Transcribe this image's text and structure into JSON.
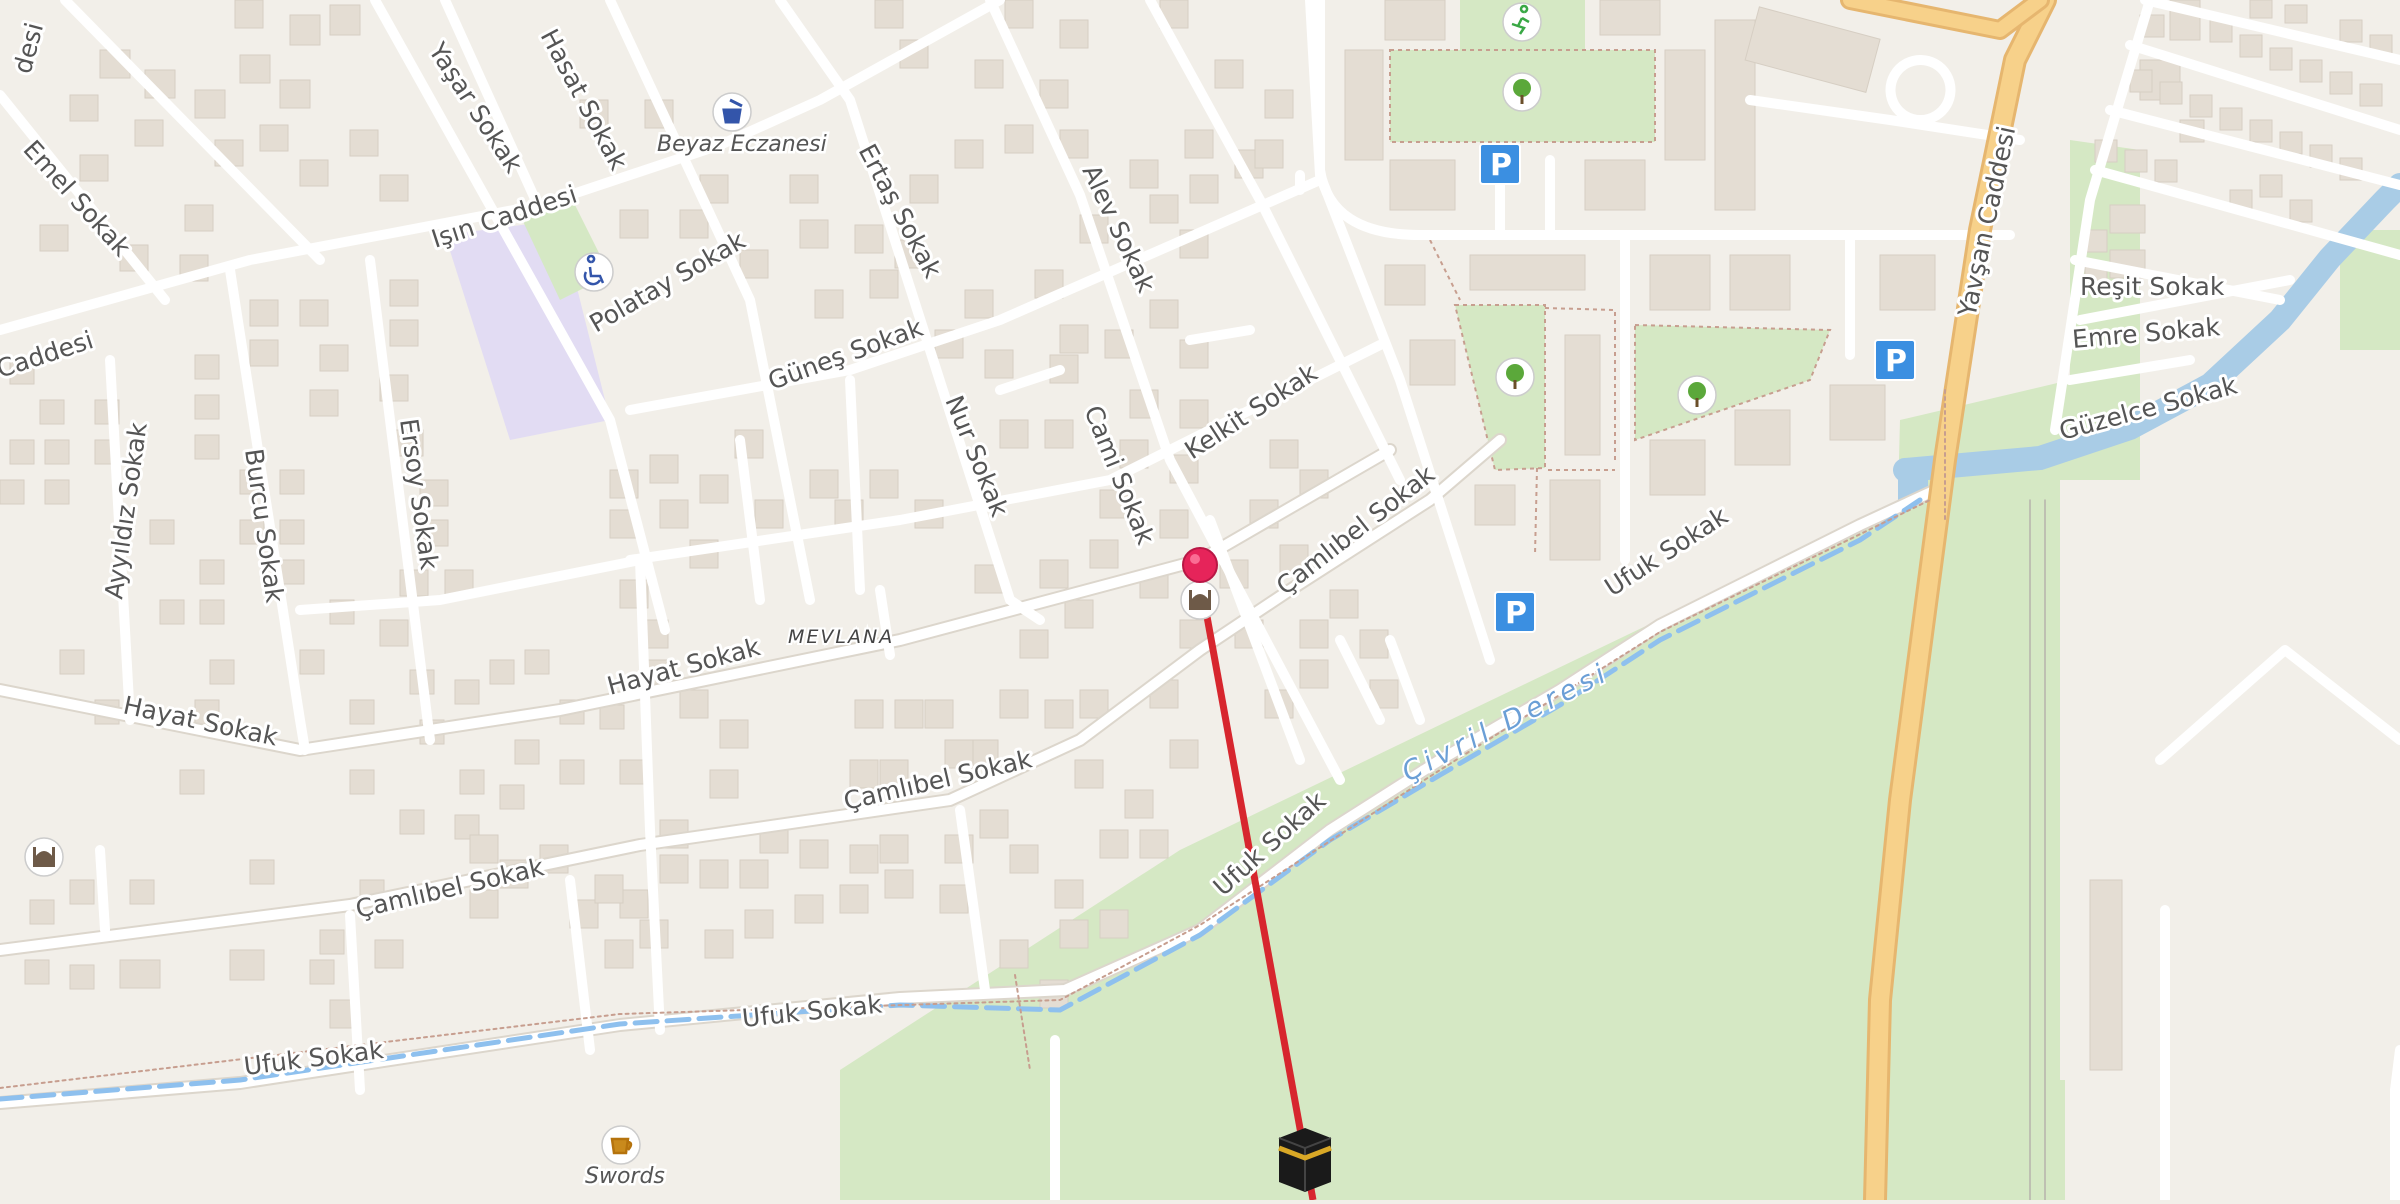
{
  "map": {
    "colors": {
      "background": "#f2efe9",
      "building": "#e4ddd3",
      "park": "#d5e8c4",
      "school": "#e2dcf3",
      "road": "#ffffff",
      "primary_road": "#f7d18a",
      "river": "#a9cce6",
      "route": "#d7262e",
      "parking": "#3b8fe1"
    },
    "streets": [
      {
        "name": "Caddesi",
        "label": "desi"
      },
      {
        "name": "Emel Sokak",
        "label": "Emel Sokak"
      },
      {
        "name": "Yaşar Sokak",
        "label": "Yaşar Sokak"
      },
      {
        "name": "Hasat Sokak",
        "label": "Hasat Sokak"
      },
      {
        "name": "Işın Caddesi",
        "label": "Işın Caddesi"
      },
      {
        "name": "Caddesi",
        "label": "Caddesi"
      },
      {
        "name": "Polatay Sokak",
        "label": "Polatay Sokak"
      },
      {
        "name": "Ertaş Sokak",
        "label": "Ertaş Sokak"
      },
      {
        "name": "Alev Sokak",
        "label": "Alev Sokak"
      },
      {
        "name": "Güneş Sokak",
        "label": "Güneş Sokak"
      },
      {
        "name": "Nur Sokak",
        "label": "Nur Sokak"
      },
      {
        "name": "Cami Sokak",
        "label": "Cami Sokak"
      },
      {
        "name": "Kelkit Sokak",
        "label": "Kelkit Sokak"
      },
      {
        "name": "Çamlıbel Sokak",
        "label": "Çamlıbel Sokak"
      },
      {
        "name": "Ayyıldız Sokak",
        "label": "Ayyıldız Sokak"
      },
      {
        "name": "Burcu Sokak",
        "label": "Burcu Sokak"
      },
      {
        "name": "Ersoy Sokak",
        "label": "Ersoy Sokak"
      },
      {
        "name": "Hayat Sokak",
        "label": "Hayat Sokak"
      },
      {
        "name": "Hayat Sokak",
        "label": "Hayat Sokak"
      },
      {
        "name": "Çamlıbel Sokak",
        "label": "Çamlıbel Sokak"
      },
      {
        "name": "Çamlıbel Sokak",
        "label": "Çamlıbel Sokak"
      },
      {
        "name": "Ufuk Sokak",
        "label": "Ufuk Sokak"
      },
      {
        "name": "Ufuk Sokak",
        "label": "Ufuk Sokak"
      },
      {
        "name": "Ufuk Sokak",
        "label": "Ufuk Sokak"
      },
      {
        "name": "Ufuk Sokak",
        "label": "Ufuk Sokak"
      },
      {
        "name": "Yavşan Caddesi",
        "label": "Yavşan Caddesi"
      },
      {
        "name": "Reşit Sokak",
        "label": "Reşit Sokak"
      },
      {
        "name": "Emre Sokak",
        "label": "Emre Sokak"
      },
      {
        "name": "Güzelce Sokak",
        "label": "Güzelce Sokak"
      }
    ],
    "district": "MEVLANA",
    "waterway": "Çivril Deresi",
    "pois": [
      {
        "icon": "pharmacy-icon",
        "label": "Beyaz Eczanesi"
      },
      {
        "icon": "cafe-icon",
        "label": "Swords"
      },
      {
        "icon": "mosque-icon",
        "label": ""
      },
      {
        "icon": "mosque-icon",
        "label": ""
      },
      {
        "icon": "disabled-access-icon",
        "label": ""
      },
      {
        "icon": "sports-icon",
        "label": ""
      },
      {
        "icon": "tree-icon",
        "label": ""
      },
      {
        "icon": "tree-icon",
        "label": ""
      },
      {
        "icon": "tree-icon",
        "label": ""
      }
    ],
    "parking_label": "P",
    "markers": {
      "origin": {
        "icon": "map-pin-icon"
      },
      "destination": {
        "icon": "kaaba-icon"
      }
    }
  }
}
